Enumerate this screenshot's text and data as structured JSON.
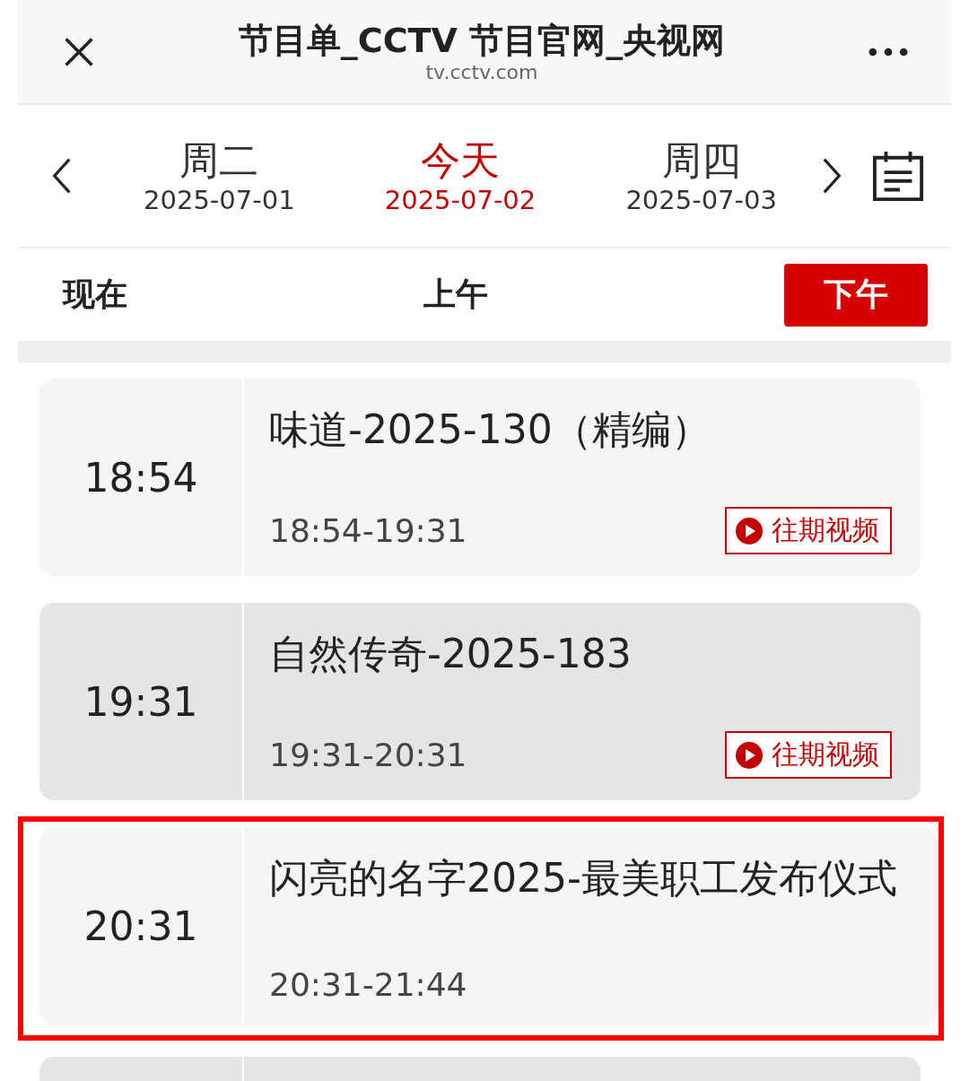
{
  "header": {
    "title": "节目单_CCTV 节目官网_央视网",
    "url": "tv.cctv.com"
  },
  "days": [
    {
      "weekday": "周二",
      "date": "2025-07-01",
      "selected": false
    },
    {
      "weekday": "今天",
      "date": "2025-07-02",
      "selected": true
    },
    {
      "weekday": "周四",
      "date": "2025-07-03",
      "selected": false
    }
  ],
  "periods": [
    {
      "label": "现在",
      "selected": false
    },
    {
      "label": "上午",
      "selected": false
    },
    {
      "label": "下午",
      "selected": true
    }
  ],
  "programs": [
    {
      "time": "18:54",
      "title": "味道-2025-130（精编）",
      "range": "18:54-19:31",
      "replay": "往期视频",
      "highlighted": false
    },
    {
      "time": "19:31",
      "title": "自然传奇-2025-183",
      "range": "19:31-20:31",
      "replay": "往期视频",
      "highlighted": false
    },
    {
      "time": "20:31",
      "title": "闪亮的名字2025-最美职工发布仪式",
      "range": "20:31-21:44",
      "highlighted": true
    }
  ]
}
